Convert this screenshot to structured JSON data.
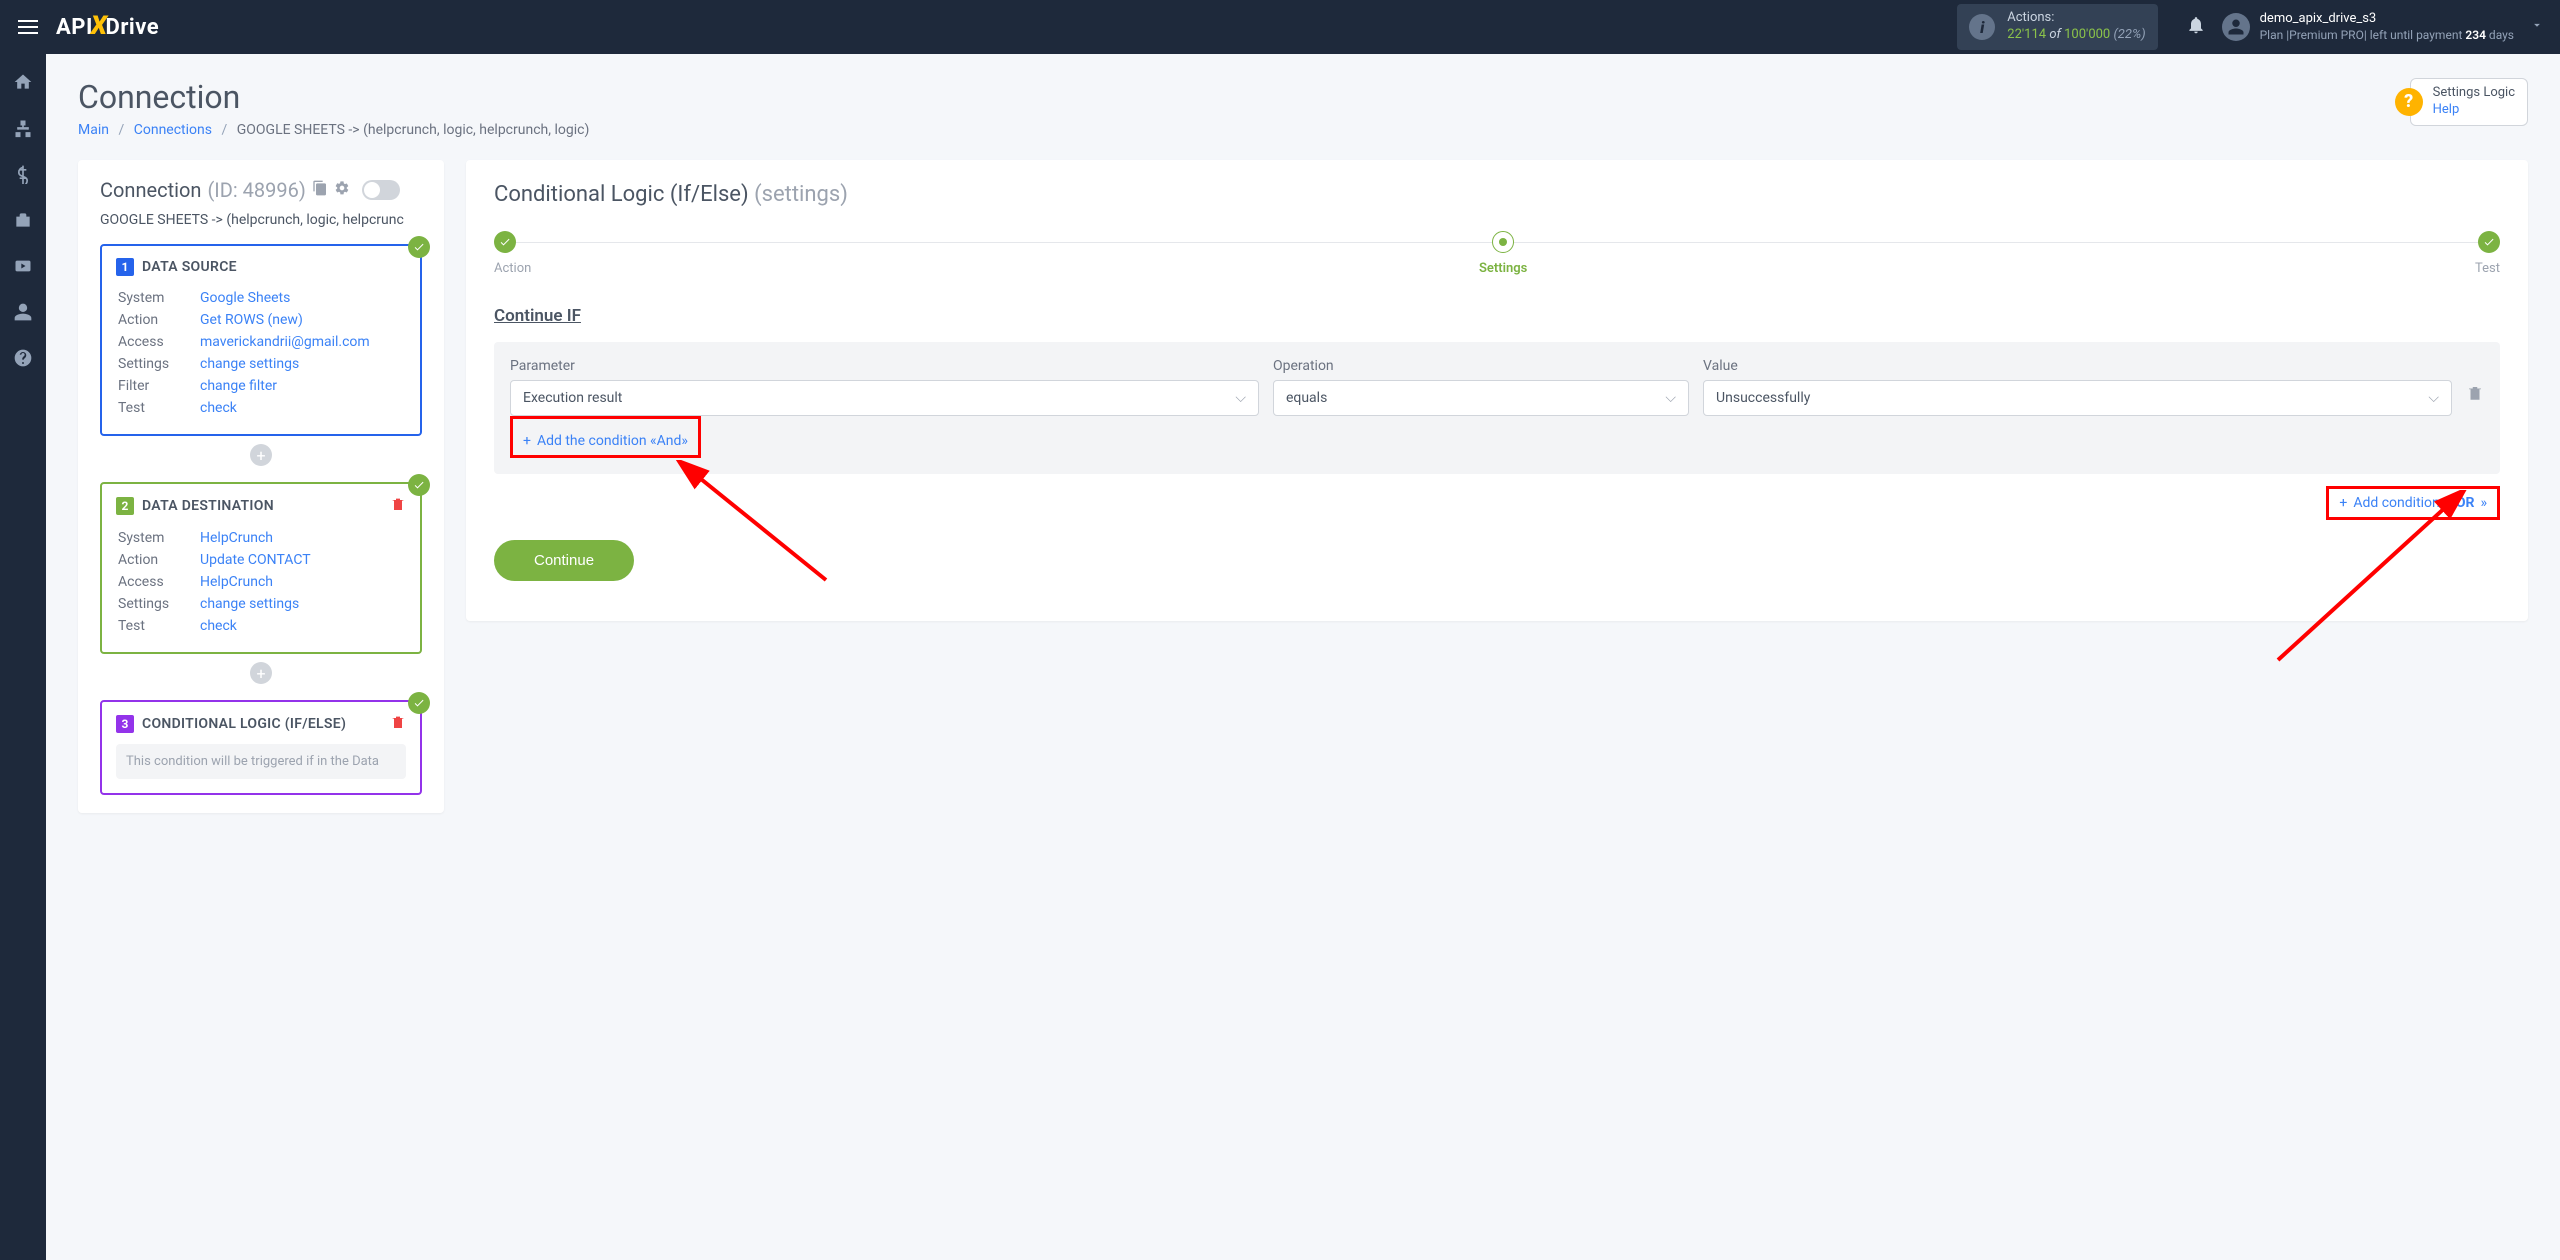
{
  "header": {
    "logo_api": "API",
    "logo_drive": "Drive",
    "actions_label": "Actions:",
    "actions_used": "22'114",
    "actions_of": "of",
    "actions_total": "100'000",
    "actions_pct": "(22%)",
    "user_name": "demo_apix_drive_s3",
    "plan_prefix": "Plan |",
    "plan_name": "Premium PRO",
    "plan_suffix": "| left until payment",
    "plan_days": "234",
    "plan_days_label": "days"
  },
  "page": {
    "title": "Connection",
    "help_title": "Settings Logic",
    "help_link": "Help"
  },
  "breadcrumb": {
    "main": "Main",
    "connections": "Connections",
    "current": "GOOGLE SHEETS -> (helpcrunch, logic, helpcrunch, logic)"
  },
  "left": {
    "conn_label": "Connection",
    "conn_id": "(ID: 48996)",
    "conn_path": "GOOGLE SHEETS -> (helpcrunch, logic, helpcrunc",
    "labels": {
      "system": "System",
      "action": "Action",
      "access": "Access",
      "settings": "Settings",
      "filter": "Filter",
      "test": "Test"
    },
    "source": {
      "num": "1",
      "title": "DATA SOURCE",
      "system": "Google Sheets",
      "action": "Get ROWS (new)",
      "access": "maverickandrii@gmail.com",
      "settings": "change settings",
      "filter": "change filter",
      "test": "check"
    },
    "dest": {
      "num": "2",
      "title": "DATA DESTINATION",
      "system": "HelpCrunch",
      "action": "Update CONTACT",
      "access": "HelpCrunch",
      "settings": "change settings",
      "test": "check"
    },
    "logic": {
      "num": "3",
      "title": "CONDITIONAL LOGIC (IF/ELSE)",
      "note": "This condition will be triggered if in the Data"
    }
  },
  "right": {
    "title": "Conditional Logic (If/Else)",
    "subtitle": "(settings)",
    "stepper": {
      "action": "Action",
      "settings": "Settings",
      "test": "Test"
    },
    "section": "Continue IF",
    "col_param": "Parameter",
    "col_op": "Operation",
    "col_val": "Value",
    "param_val": "Execution result",
    "op_val": "equals",
    "val_val": "Unsuccessfully",
    "add_and": "Add the condition «And»",
    "add_or_prefix": "Add condition «",
    "add_or_strong": "OR",
    "add_or_suffix": "»",
    "continue": "Continue"
  }
}
